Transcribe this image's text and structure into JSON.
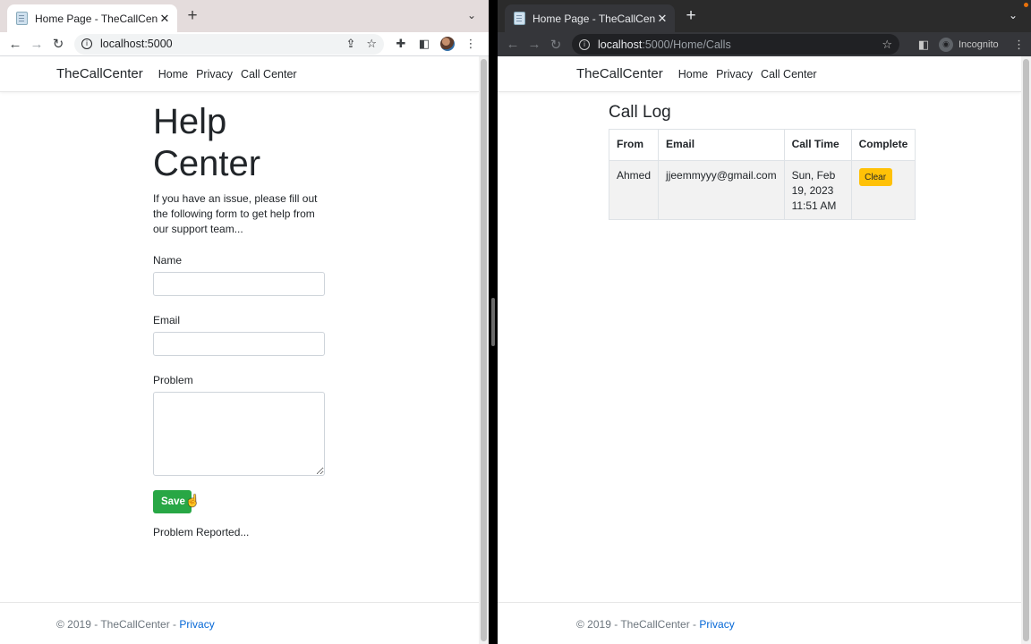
{
  "left_window": {
    "tab": {
      "title": "Home Page - TheCallCenter",
      "close": "✕"
    },
    "new_tab": "+",
    "tab_menu": "⌄",
    "nav": {
      "back": "←",
      "forward": "→",
      "reload": "↻"
    },
    "address": {
      "url": "localhost:5000"
    },
    "site": {
      "brand": "TheCallCenter",
      "links": [
        "Home",
        "Privacy",
        "Call Center"
      ]
    },
    "form": {
      "heading": "Help Center",
      "intro": "If you have an issue, please fill out the following form to get help from our support team...",
      "name_label": "Name",
      "email_label": "Email",
      "problem_label": "Problem",
      "name_value": "",
      "email_value": "",
      "problem_value": "",
      "save_label": "Save",
      "status": "Problem Reported..."
    },
    "footer": {
      "text": "© 2019 - TheCallCenter - ",
      "link": "Privacy"
    }
  },
  "right_window": {
    "tab": {
      "title": "Home Page - TheCallCenter",
      "close": "✕"
    },
    "new_tab": "+",
    "tab_menu": "⌄",
    "nav": {
      "back": "←",
      "forward": "→",
      "reload": "↻"
    },
    "address": {
      "host": "localhost",
      "path": ":5000/Home/Calls"
    },
    "incognito_label": "Incognito",
    "site": {
      "brand": "TheCallCenter",
      "links": [
        "Home",
        "Privacy",
        "Call Center"
      ]
    },
    "call_log": {
      "heading": "Call Log",
      "columns": [
        "From",
        "Email",
        "Call Time",
        "Complete"
      ],
      "rows": [
        {
          "from": "Ahmed",
          "email": "jjeemmyyy@gmail.com",
          "time_lines": [
            "Sun, Feb",
            "19, 2023",
            "11:51 AM"
          ],
          "action": "Clear"
        }
      ]
    },
    "footer": {
      "text": "© 2019 - TheCallCenter - ",
      "link": "Privacy"
    }
  },
  "colors": {
    "save_button": "#28a745",
    "clear_button": "#ffc107",
    "link": "#0366d6",
    "incognito_chrome": "#35363a"
  }
}
